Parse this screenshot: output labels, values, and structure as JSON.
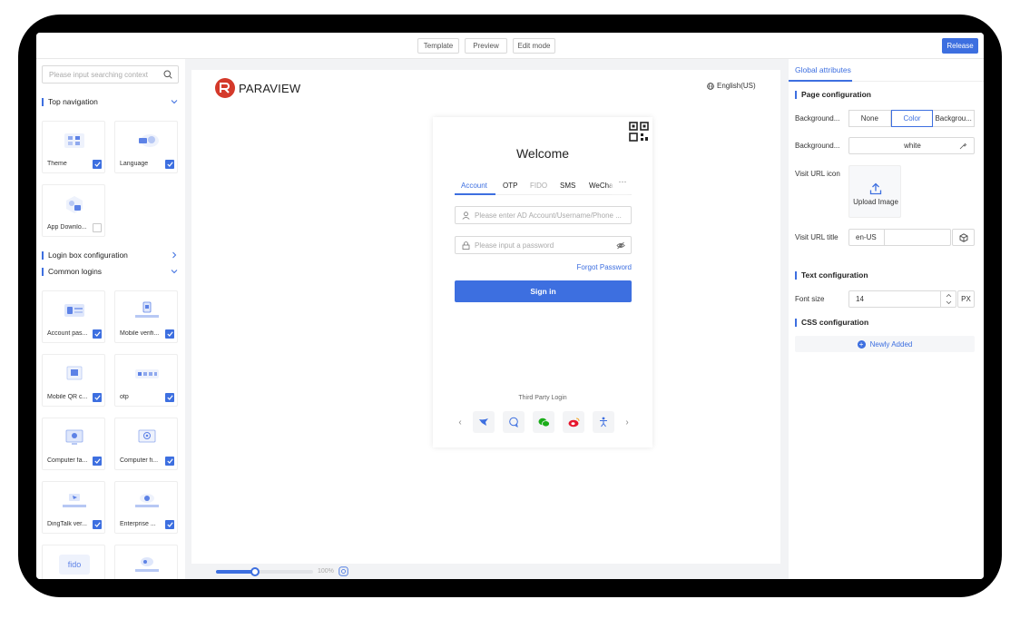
{
  "topbar": {
    "template_label": "Template",
    "preview_label": "Preview",
    "edit_mode_label": "Edit mode",
    "release_label": "Release"
  },
  "left_panel": {
    "search_placeholder": "Please input searching context",
    "sections": {
      "top_navigation": "Top navigation",
      "login_box_configuration": "Login box configuration",
      "common_logins": "Common logins"
    },
    "top_nav_cards": [
      {
        "label": "Theme",
        "checked": true
      },
      {
        "label": "Language",
        "checked": true
      },
      {
        "label": "App Downlo...",
        "checked": false
      }
    ],
    "common_login_cards": [
      {
        "label": "Account pas...",
        "checked": true
      },
      {
        "label": "Mobile verifi...",
        "checked": true
      },
      {
        "label": "Mobile QR c...",
        "checked": true
      },
      {
        "label": "otp",
        "checked": true
      },
      {
        "label": "Computer fa...",
        "checked": true
      },
      {
        "label": "Computer fi...",
        "checked": true
      },
      {
        "label": "DingTalk ver...",
        "checked": true
      },
      {
        "label": "Enterprise ...",
        "checked": true
      },
      {
        "art_text": "fido"
      }
    ]
  },
  "canvas": {
    "brand_name": "PARAVIEW",
    "language": "English(US)",
    "login": {
      "welcome": "Welcome",
      "tabs": [
        "Account",
        "OTP",
        "FIDO",
        "SMS",
        "WeCha"
      ],
      "more": "···",
      "account_placeholder": "Please enter  AD Account/Username/Phone ...",
      "password_placeholder": "Please input a password",
      "forgot_password": "Forgot Password",
      "sign_in": "Sign in",
      "third_party_login": "Third Party Login"
    },
    "zoom_text": "100%",
    "zoom_fraction": 0.4
  },
  "right_panel": {
    "tab_global": "Global attributes",
    "page_configuration": "Page configuration",
    "background_label_1": "Background...",
    "background_options": [
      "None",
      "Color",
      "Backgrou..."
    ],
    "background_selected": "Color",
    "background_label_2": "Background...",
    "background_color_value": "white",
    "visit_url_icon": "Visit URL icon",
    "upload_image": "Upload Image",
    "visit_url_title": "Visit URL title",
    "visit_url_title_value": "en-US",
    "text_configuration": "Text configuration",
    "font_size_label": "Font size",
    "font_size_value": "14",
    "font_size_unit": "PX",
    "css_configuration": "CSS configuration",
    "newly_added": "Newly Added"
  },
  "colors": {
    "accent": "#3d6fe0",
    "brand_red": "#d4392a"
  }
}
